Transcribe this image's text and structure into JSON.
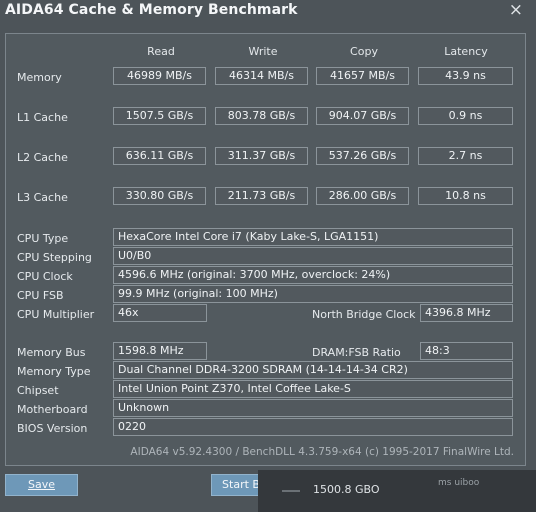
{
  "window": {
    "title": "AIDA64 Cache & Memory Benchmark",
    "close_symbol": "×"
  },
  "columns": {
    "read": "Read",
    "write": "Write",
    "copy": "Copy",
    "latency": "Latency"
  },
  "bench": {
    "memory": {
      "label": "Memory",
      "read": "46989 MB/s",
      "write": "46314 MB/s",
      "copy": "41657 MB/s",
      "latency": "43.9 ns"
    },
    "l1": {
      "label": "L1 Cache",
      "read": "1507.5 GB/s",
      "write": "803.78 GB/s",
      "copy": "904.07 GB/s",
      "latency": "0.9 ns"
    },
    "l2": {
      "label": "L2 Cache",
      "read": "636.11 GB/s",
      "write": "311.37 GB/s",
      "copy": "537.26 GB/s",
      "latency": "2.7 ns"
    },
    "l3": {
      "label": "L3 Cache",
      "read": "330.80 GB/s",
      "write": "211.73 GB/s",
      "copy": "286.00 GB/s",
      "latency": "10.8 ns"
    }
  },
  "info": {
    "cpu_type": {
      "label": "CPU Type",
      "value": "HexaCore Intel Core i7  (Kaby Lake-S, LGA1151)"
    },
    "cpu_stepping": {
      "label": "CPU Stepping",
      "value": "U0/B0"
    },
    "cpu_clock": {
      "label": "CPU Clock",
      "value": "4596.6 MHz  (original: 3700 MHz, overclock: 24%)"
    },
    "cpu_fsb": {
      "label": "CPU FSB",
      "value": "99.9 MHz  (original: 100 MHz)"
    },
    "cpu_multiplier": {
      "label": "CPU Multiplier",
      "value": "46x"
    },
    "nb_clock": {
      "label": "North Bridge Clock",
      "value": "4396.8 MHz"
    },
    "memory_bus": {
      "label": "Memory Bus",
      "value": "1598.8 MHz"
    },
    "dram_fsb": {
      "label": "DRAM:FSB Ratio",
      "value": "48:3"
    },
    "memory_type": {
      "label": "Memory Type",
      "value": "Dual Channel DDR4-3200 SDRAM  (14-14-14-34 CR2)"
    },
    "chipset": {
      "label": "Chipset",
      "value": "Intel Union Point Z370, Intel Coffee Lake-S"
    },
    "motherboard": {
      "label": "Motherboard",
      "value": "Unknown"
    },
    "bios": {
      "label": "BIOS Version",
      "value": "0220"
    }
  },
  "footer": {
    "text": "AIDA64 v5.92.4300 / BenchDLL 4.3.759-x64  (c) 1995-2017 FinalWire Ltd."
  },
  "buttons": {
    "save": "Save",
    "start": "Start B"
  },
  "overlay": {
    "value": "1500.8 GBO",
    "text": "ms uiboo"
  }
}
